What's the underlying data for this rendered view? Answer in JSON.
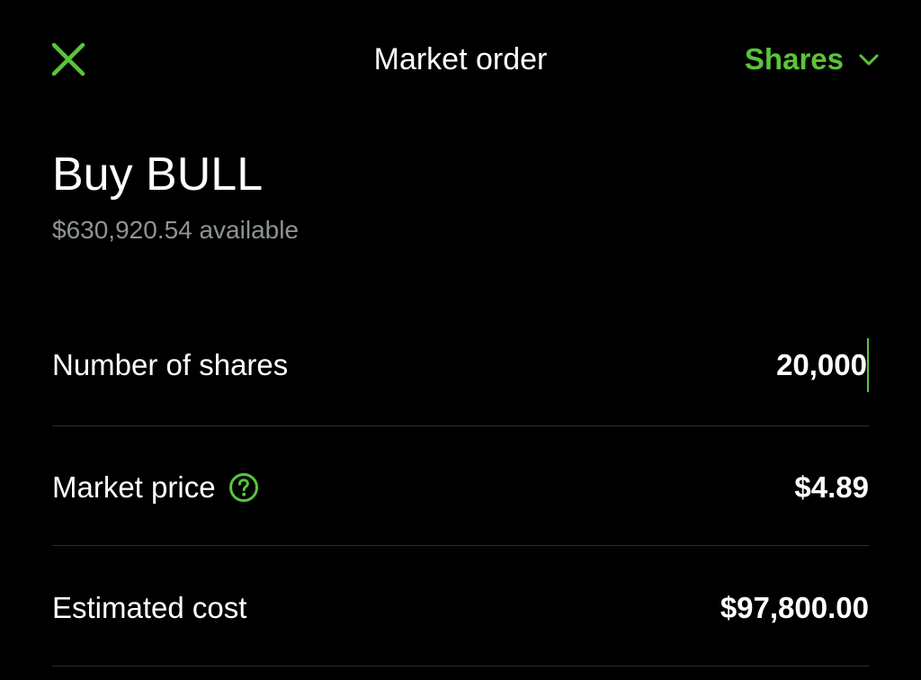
{
  "colors": {
    "accent": "#5ac53b",
    "background": "#000000",
    "text_primary": "#ffffff",
    "text_secondary": "#8e9396",
    "divider": "#2b2d2f"
  },
  "header": {
    "close_icon": "close-icon",
    "title": "Market order",
    "order_type_label": "Shares",
    "order_type_icon": "chevron-down-icon"
  },
  "order": {
    "title": "Buy BULL",
    "available": "$630,920.54 available"
  },
  "rows": [
    {
      "label": "Number of shares",
      "value": "20,000"
    },
    {
      "label": "Market price",
      "value": "$4.89",
      "icon": "help-icon"
    },
    {
      "label": "Estimated cost",
      "value": "$97,800.00"
    }
  ]
}
